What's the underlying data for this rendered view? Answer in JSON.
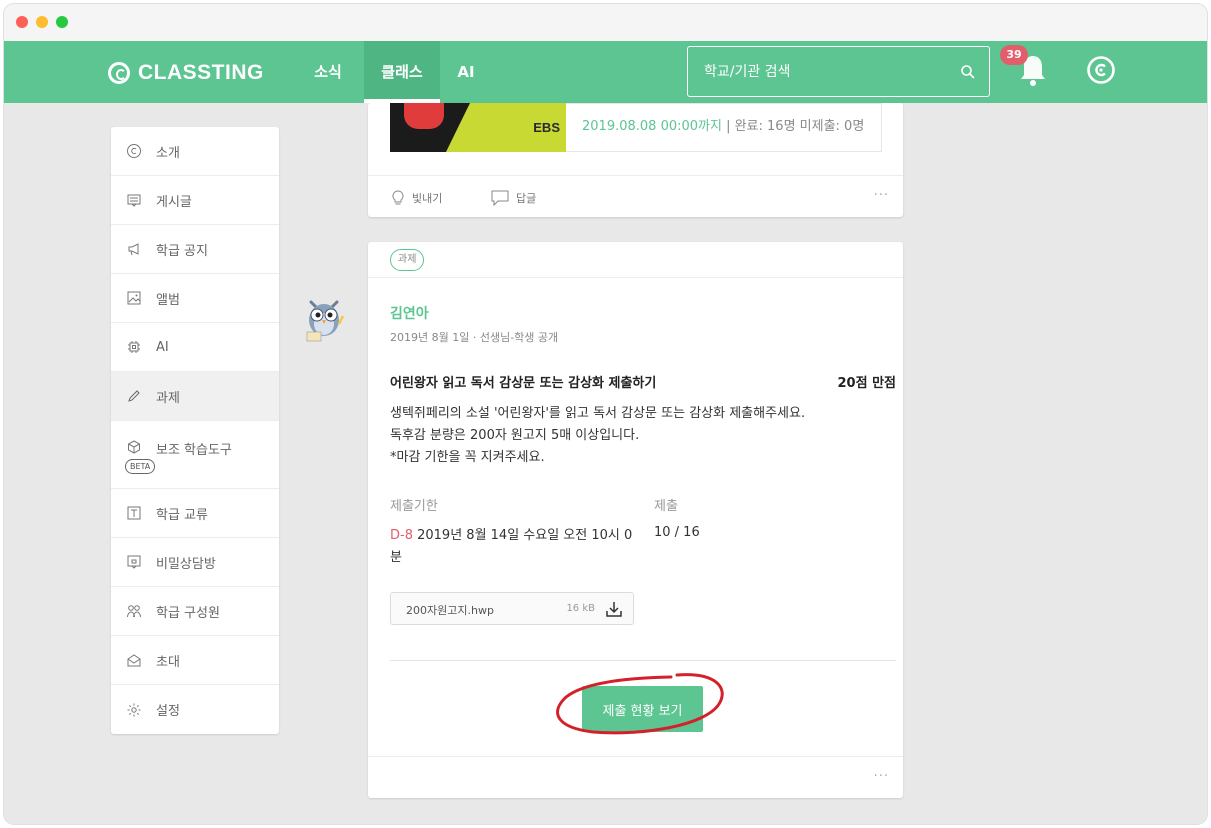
{
  "nav": {
    "logo": "CLASSTING",
    "items": [
      "소식",
      "클래스",
      "AI"
    ],
    "active": "클래스",
    "search_placeholder": "학교/기관 검색",
    "notification_count": "39"
  },
  "sidebar": {
    "items": [
      {
        "label": "소개",
        "icon": "copyright-icon"
      },
      {
        "label": "게시글",
        "icon": "post-icon"
      },
      {
        "label": "학급 공지",
        "icon": "megaphone-icon"
      },
      {
        "label": "앨범",
        "icon": "album-icon"
      },
      {
        "label": "AI",
        "icon": "chip-icon"
      },
      {
        "label": "과제",
        "icon": "pencil-icon"
      },
      {
        "label": "보조 학습도구",
        "icon": "cube-icon",
        "badge": "BETA"
      },
      {
        "label": "학급 교류",
        "icon": "exchange-icon"
      },
      {
        "label": "비밀상담방",
        "icon": "secret-chat-icon"
      },
      {
        "label": "학급 구성원",
        "icon": "members-icon"
      },
      {
        "label": "초대",
        "icon": "invite-icon"
      },
      {
        "label": "설정",
        "icon": "gear-icon"
      }
    ],
    "active": "과제"
  },
  "prev_post": {
    "thumb_label": "EBS",
    "deadline": "2019.08.08 00:00까지",
    "stats": " | 완료: 16명 미제출: 0명",
    "like_label": "빛내기",
    "comment_label": "답글",
    "more": "···"
  },
  "post": {
    "tag": "과제",
    "author": "김연아",
    "date": "2019년 8월 1일 · 선생님-학생 공개",
    "title": "어린왕자 읽고 독서 감상문 또는 감상화 제출하기",
    "points": "20점 만점",
    "description": [
      "생텍쥐페리의 소설 '어린왕자'를 읽고 독서 감상문 또는 감상화 제출해주세요.",
      "독후감 분량은 200자 원고지 5매 이상입니다.",
      "*마감 기한을 꼭 지켜주세요."
    ],
    "deadline_label": "제출기한",
    "submit_label": "제출",
    "dday": "D-8",
    "deadline_text": " 2019년 8월 14일 수요일 오전 10시 0분",
    "submit_count": "10 / 16",
    "file": {
      "name": "200자원고지.hwp",
      "size": "16 kB"
    },
    "status_button": "제출 현황 보기",
    "more": "···"
  },
  "colors": {
    "brand": "#5cc592",
    "alert": "#e35d6a",
    "annotation": "#d4202a"
  }
}
